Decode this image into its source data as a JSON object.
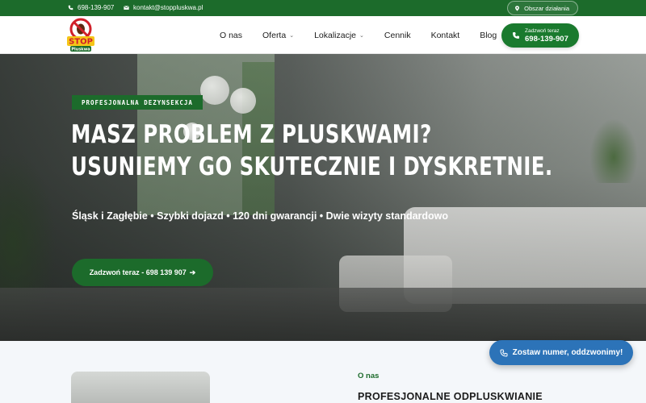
{
  "topbar": {
    "phone": "698-139-907",
    "email": "kontakt@stoppluskwa.pl",
    "area_label": "Obszar działania"
  },
  "header": {
    "logo_text_top": "STOP",
    "logo_text_bottom": "Pluskwa",
    "nav": [
      {
        "label": "O nas"
      },
      {
        "label": "Oferta"
      },
      {
        "label": "Lokalizacje"
      },
      {
        "label": "Cennik"
      },
      {
        "label": "Kontakt"
      },
      {
        "label": "Blog"
      }
    ],
    "call_label": "Zadzwoń teraz",
    "call_number": "698-139-907"
  },
  "hero": {
    "badge": "PROFESJONALNA DEZYNSEKCJA",
    "title_line1": "MASZ PROBLEM Z PLUSKWAMI?",
    "title_line2": "USUNIEMY GO SKUTECZNIE I DYSKRETNIE.",
    "subtitle": "Śląsk i Zagłębie • Szybki dojazd • 120 dni gwarancji • Dwie wizyty standardowo",
    "cta_label": "Zadzwoń teraz - 698 139 907"
  },
  "about": {
    "label": "O nas",
    "title": "PROFESJONALNE ODPLUSKWIANIE"
  },
  "callback": {
    "label": "Zostaw numer, oddzwonimy!"
  },
  "colors": {
    "brand_green": "#1c6b2b",
    "callback_blue": "#2c73b8"
  }
}
